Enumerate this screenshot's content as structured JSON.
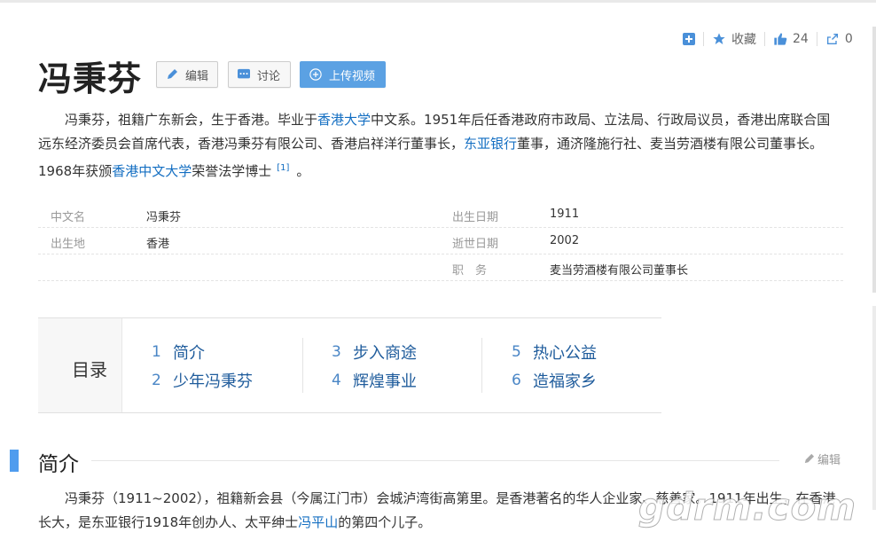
{
  "actions": {
    "collect_label": "收藏",
    "like_count": "24",
    "share_count": "0"
  },
  "title": "冯秉芬",
  "buttons": {
    "edit": "编辑",
    "discuss": "讨论",
    "upload": "上传视频"
  },
  "summary": {
    "t1": "冯秉芬，祖籍广东新会，生于香港。毕业于",
    "link1": "香港大学",
    "t2": "中文系。1951年后任香港政府市政局、立法局、行政局议员，香港出席联合国远东经济委员会首席代表，香港冯秉芬有限公司、香港启祥洋行董事长，",
    "link2": "东亚银行",
    "t3": "董事，通济隆施行社、麦当劳酒楼有限公司董事长。1968年获颁",
    "link3": "香港中文大学",
    "t4": "荣誉法学博士",
    "ref": "[1]",
    "t5": "。"
  },
  "basic_info": [
    {
      "k1": "中文名",
      "v1": "冯秉芬",
      "k2": "出生日期",
      "v2": "1911"
    },
    {
      "k1": "出生地",
      "v1": "香港",
      "k2": "逝世日期",
      "v2": "2002"
    },
    {
      "k1": "",
      "v1": "",
      "k2": "职　务",
      "v2": "麦当劳酒楼有限公司董事长"
    }
  ],
  "catalog": {
    "title": "目录",
    "items": [
      {
        "num": "1",
        "label": "简介"
      },
      {
        "num": "2",
        "label": "少年冯秉芬"
      },
      {
        "num": "3",
        "label": "步入商途"
      },
      {
        "num": "4",
        "label": "辉煌事业"
      },
      {
        "num": "5",
        "label": "热心公益"
      },
      {
        "num": "6",
        "label": "造福家乡"
      }
    ]
  },
  "section": {
    "title": "简介",
    "edit_label": "编辑"
  },
  "intro": {
    "t1": "冯秉芬（1911~2002），祖籍新会县（今属江门市）会城泸湾街高第里。是香港著名的华人",
    "hidden": "企业家、慈善家",
    "t2": "。1911年出生，在香港长大，是东亚银行1918年创办人、太平绅士",
    "link": "冯平山",
    "t3": "的第四个儿子。"
  },
  "watermark": "gdrm.com",
  "colors": {
    "link": "#136ec2",
    "accent": "#4f9cee",
    "upload_button": "#5ba1e3"
  }
}
